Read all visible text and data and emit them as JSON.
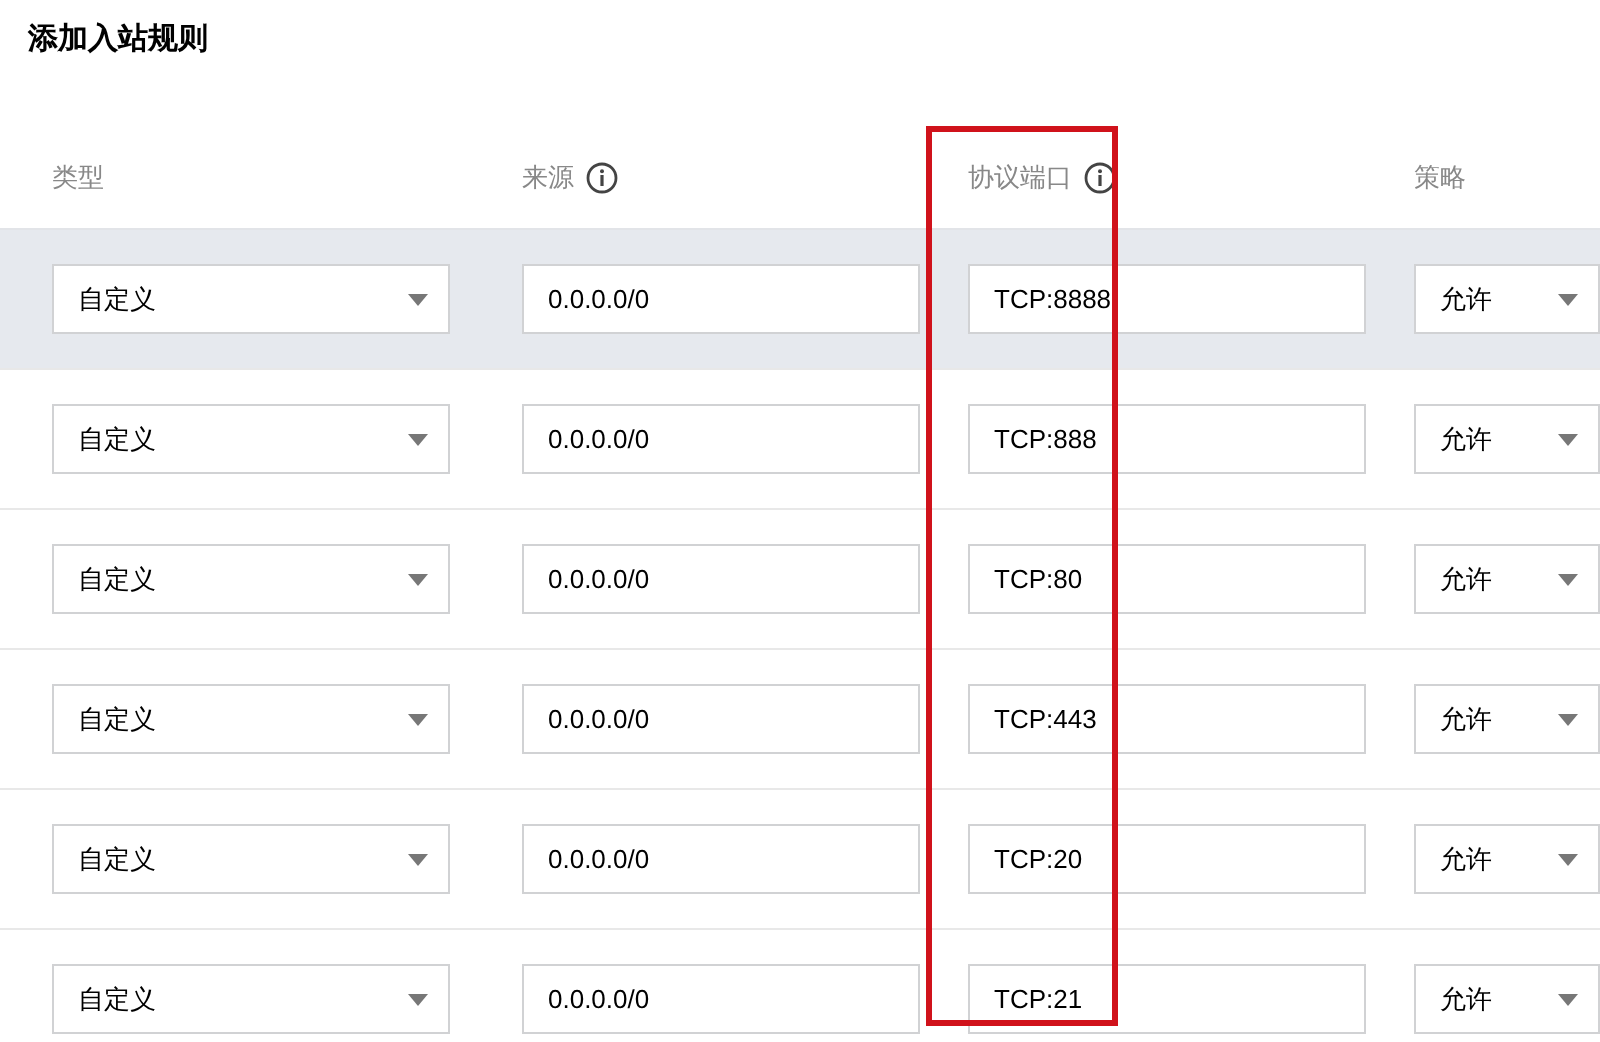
{
  "title": "添加入站规则",
  "table": {
    "columns": [
      {
        "label": "类型",
        "info": false,
        "highlighted": false
      },
      {
        "label": "来源",
        "info": true,
        "highlighted": false
      },
      {
        "label": "协议端口",
        "info": true,
        "highlighted": true
      },
      {
        "label": "策略",
        "info": false,
        "highlighted": false
      }
    ],
    "rows": [
      {
        "selected": true,
        "type": "自定义",
        "source": "0.0.0.0/0",
        "port": "TCP:8888",
        "policy": "允许"
      },
      {
        "selected": false,
        "type": "自定义",
        "source": "0.0.0.0/0",
        "port": "TCP:888",
        "policy": "允许"
      },
      {
        "selected": false,
        "type": "自定义",
        "source": "0.0.0.0/0",
        "port": "TCP:80",
        "policy": "允许"
      },
      {
        "selected": false,
        "type": "自定义",
        "source": "0.0.0.0/0",
        "port": "TCP:443",
        "policy": "允许"
      },
      {
        "selected": false,
        "type": "自定义",
        "source": "0.0.0.0/0",
        "port": "TCP:20",
        "policy": "允许"
      },
      {
        "selected": false,
        "type": "自定义",
        "source": "0.0.0.0/0",
        "port": "TCP:21",
        "policy": "允许"
      }
    ]
  }
}
